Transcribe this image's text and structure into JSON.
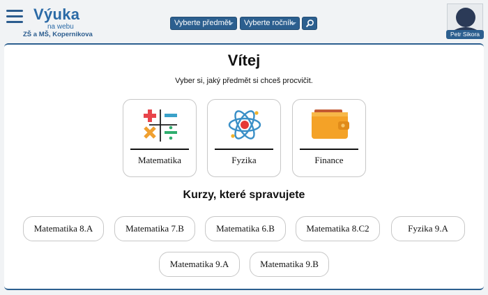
{
  "header": {
    "brand_title": "Výuka",
    "brand_sub": "na webu",
    "brand_school": "ZŠ a MŠ, Kopernikova",
    "subject_select": "Vyberte předmět",
    "grade_select": "Vyberte ročník",
    "user_name": "Petr Sikora"
  },
  "main": {
    "welcome": "Vítej",
    "intro": "Vyber si, jaký předmět si chceš procvičit.",
    "subjects": [
      {
        "label": "Matematika",
        "icon": "math-operations-icon"
      },
      {
        "label": "Fyzika",
        "icon": "atom-icon"
      },
      {
        "label": "Finance",
        "icon": "wallet-icon"
      }
    ],
    "courses_title": "Kurzy, které spravujete",
    "courses": [
      "Matematika 8.A",
      "Matematika 7.B",
      "Matematika 6.B",
      "Matematika 8.C2",
      "Fyzika 9.A",
      "Matematika 9.A",
      "Matematika 9.B"
    ]
  },
  "colors": {
    "accent": "#2c5f8f",
    "brand": "#2b6aa6"
  }
}
